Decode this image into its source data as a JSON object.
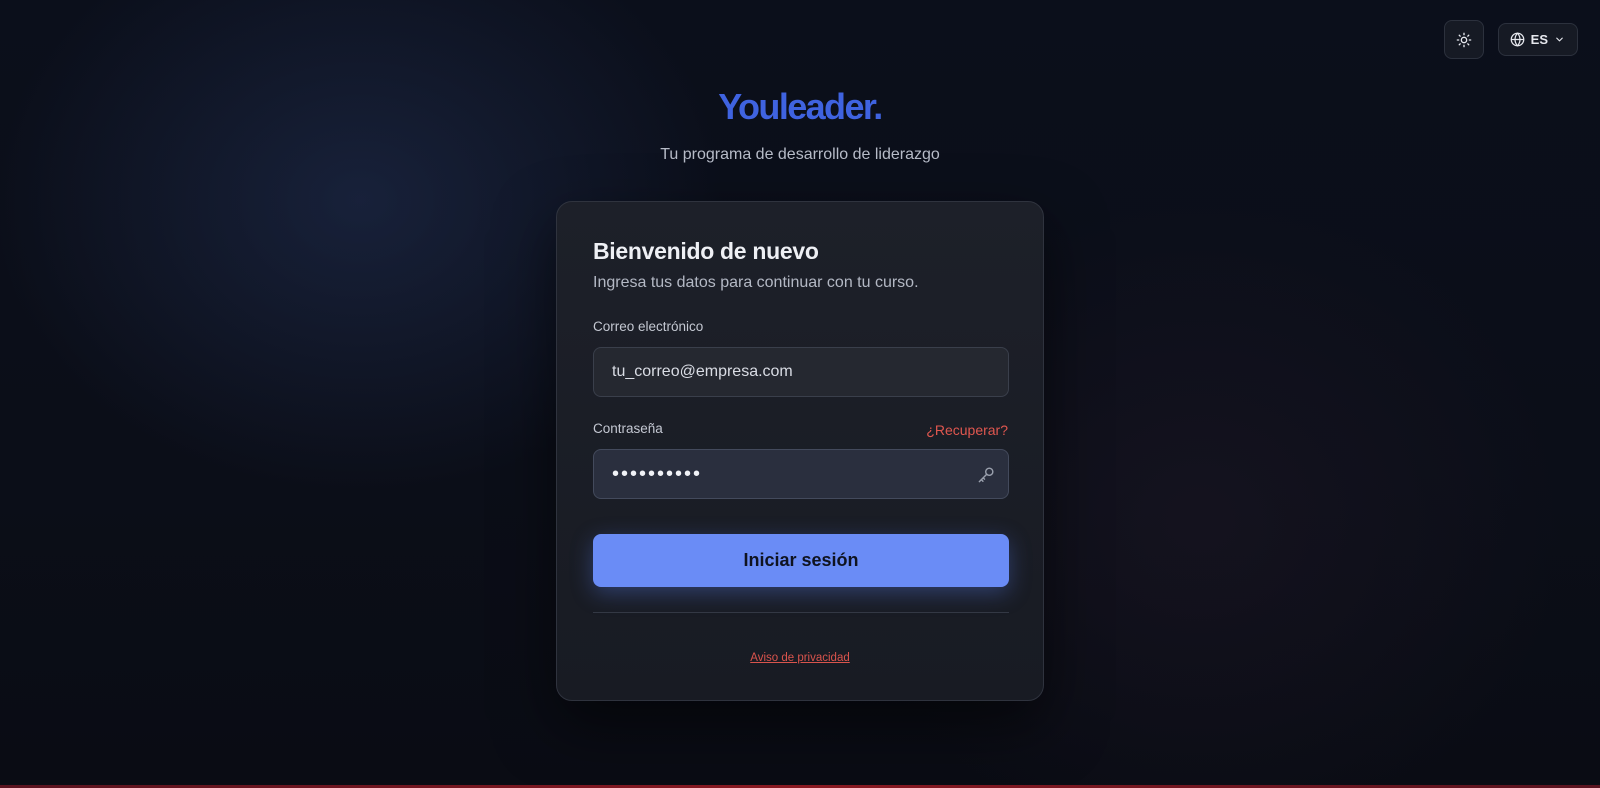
{
  "header": {
    "language": "ES",
    "theme_icon": "sun-icon",
    "language_icon": "globe-icon",
    "language_chevron_icon": "chevron-down-icon"
  },
  "brand": {
    "name": "Youleader.",
    "tagline": "Tu programa de desarrollo de liderazgo",
    "color": "#3f63e0"
  },
  "login": {
    "title": "Bienvenido de nuevo",
    "subtitle": "Ingresa tus datos para continuar con tu curso.",
    "email_label": "Correo electrónico",
    "email_value": "tu_correo@empresa.com",
    "password_label": "Contraseña",
    "password_value": "••••••••••",
    "password_icon": "key-icon",
    "recover_label": "¿Recuperar?",
    "submit_label": "Iniciar sesión",
    "privacy_label": "Aviso de privacidad"
  },
  "colors": {
    "accent": "#6a8cf6",
    "link": "#e0574f",
    "background": "#0b0f1b"
  }
}
